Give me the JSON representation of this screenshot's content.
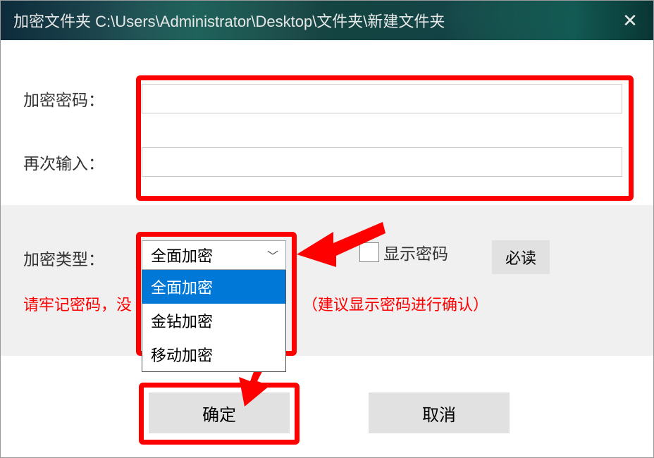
{
  "titlebar": {
    "title": "加密文件夹 C:\\Users\\Administrator\\Desktop\\文件夹\\新建文件夹"
  },
  "labels": {
    "password": "加密密码：",
    "confirm": "再次输入：",
    "type": "加密类型："
  },
  "inputs": {
    "password_value": "",
    "confirm_value": ""
  },
  "dropdown": {
    "selected": "全面加密",
    "options": [
      "全面加密",
      "金钻加密",
      "移动加密"
    ]
  },
  "checkbox": {
    "show_password_label": "显示密码",
    "checked": false
  },
  "buttons": {
    "must_read": "必读",
    "ok": "确定",
    "cancel": "取消"
  },
  "warning": {
    "prefix": "请牢记密码，没",
    "suffix": "（建议显示密码进行确认）"
  }
}
